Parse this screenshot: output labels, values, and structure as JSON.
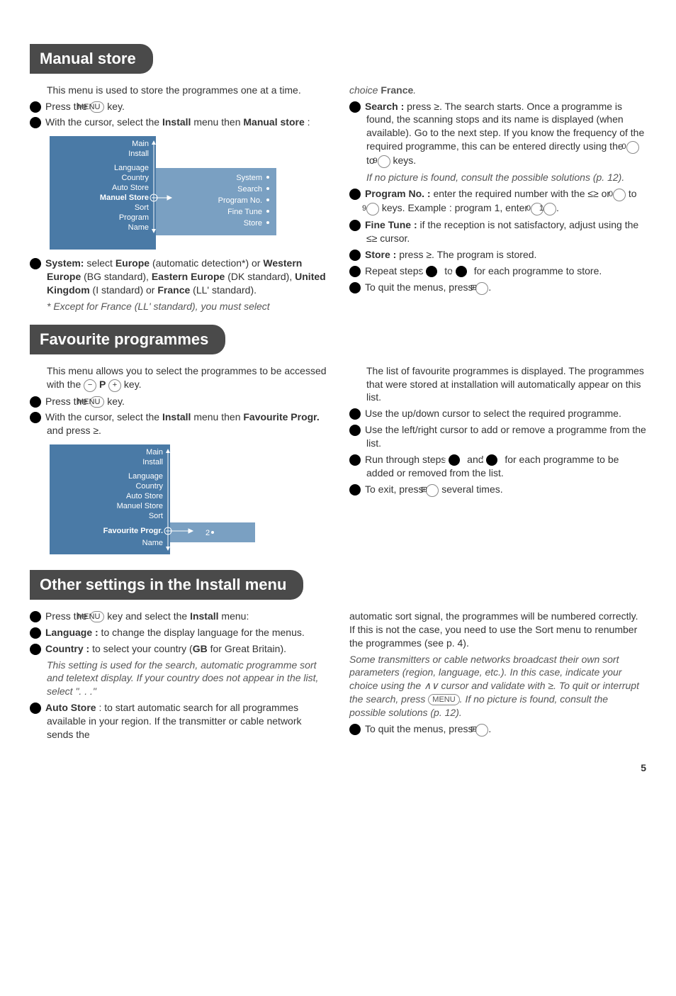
{
  "sections": {
    "manual": {
      "title": "Manual store"
    },
    "fav": {
      "title": "Favourite programmes"
    },
    "other": {
      "title": "Other settings in the Install menu"
    }
  },
  "manual": {
    "intro": "This menu is used to store the programmes one at a time.",
    "s1a": "Press the ",
    "s1b": " key.",
    "s2a": "With the cursor, select the ",
    "s2b": "Install",
    "s2c": " menu then ",
    "s2d": "Manual store",
    "s2e": " :",
    "menu": {
      "left": [
        "Main",
        "Install",
        "Language",
        "Country",
        "Auto Store",
        "Manuel Store",
        "Sort",
        "Program",
        "Name"
      ],
      "right": [
        "System",
        "Search",
        "Program No.",
        "Fine Tune",
        "Store"
      ]
    },
    "s3a": "System:",
    "s3b": " select ",
    "s3c": "Europe",
    "s3d": " (automatic detection*) or ",
    "s3e": "Western Europe",
    "s3f": " (BG standard), ",
    "s3g": "Eastern Europe",
    "s3h": " (DK standard), ",
    "s3i": "United Kingdom",
    "s3j": " (I standard) or ",
    "s3k": "France",
    "s3l": " (LL' standard).",
    "s3note_a": "* Except for France (LL' standard), you must select ",
    "s3note_b": "choice ",
    "s3note_c": "France",
    "s3note_d": ".",
    "s4a": "Search :",
    "s4b": " press ≥. The search starts. Once a programme is found, the scanning stops and its name is displayed (when available). Go to the next step. If you know the frequency of the required programme, this can be entered directly using the ",
    "s4c": " to ",
    "s4d": " keys.",
    "s4note": "If no picture is found, consult the possible solutions (p. 12).",
    "s5a": "Program No. :",
    "s5b": " enter the required number with the ≤≥ or ",
    "s5c": " to ",
    "s5d": " keys. Example : program 1, enter ",
    "s6a": "Fine Tune :",
    "s6b": " if the reception is not satisfactory, adjust using the ≤≥ cursor.",
    "s7a": "Store :",
    "s7b": " press ≥. The program is stored.",
    "s8a": "Repeat steps ",
    "s8b": " to ",
    "s8c": " for each programme to store.",
    "s9a": "To quit the menus, press ",
    "s9b": "."
  },
  "fav": {
    "intro_a": "This menu allows you to select the programmes to be accessed with the ",
    "intro_b": " P ",
    "intro_c": " key.",
    "s1a": "Press the ",
    "s1b": " key.",
    "s2a": "With the cursor, select the ",
    "s2b": "Install",
    "s2c": " menu then ",
    "s2d": "Favourite Progr.",
    "s2e": " and press ≥.",
    "menu": {
      "left": [
        "Main",
        "Install",
        "Language",
        "Country",
        "Auto Store",
        "Manuel Store",
        "Sort",
        "Favourite Progr.",
        "Name"
      ],
      "right": "2"
    },
    "r_intro": "The list of favourite programmes is displayed. The programmes that were stored at installation will automatically appear on this list.",
    "s3": "Use the up/down cursor to select the required programme.",
    "s4": "Use the left/right cursor to add or remove a programme from the list.",
    "s5a": "Run through steps ",
    "s5b": " and ",
    "s5c": " for each programme to be added or removed from the list.",
    "s6a": "To exit, press ",
    "s6b": " several times."
  },
  "other": {
    "s1a": "Press the ",
    "s1b": " key and select the ",
    "s1c": "Install",
    "s1d": " menu:",
    "s2a": "Language :",
    "s2b": " to change the display language for the menus.",
    "s3a": "Country :",
    "s3b": " to select your country (",
    "s3c": "GB",
    "s3d": " for Great Britain).",
    "s3note": "This setting is used for the search, automatic programme sort and teletext display. If your country does not appear in the list, select \". . .\"",
    "s4a": "Auto Store",
    "s4b": " : to start automatic search for all programmes available in your region. If the transmitter or cable network sends the ",
    "s4c": "automatic sort signal, the programmes will be numbered correctly. If this is not the case, you need to use the Sort menu to renumber the programmes (see p. 4).",
    "s4note_a": "Some transmitters or cable networks broadcast their own sort parameters (region, language, etc.). In this case, indicate your choice using the ∧∨ cursor and validate with ≥. To quit or interrupt the search, press ",
    "s4note_b": ". If no picture is found, consult the possible solutions (p. 12).",
    "s5a": "To quit the menus, press ",
    "s5b": "."
  },
  "keys": {
    "menu": "MENU",
    "zero": "0",
    "nine": "9",
    "one": "1",
    "minus": "−",
    "plus": "+",
    "txt": "⊞"
  },
  "pagenum": "5"
}
